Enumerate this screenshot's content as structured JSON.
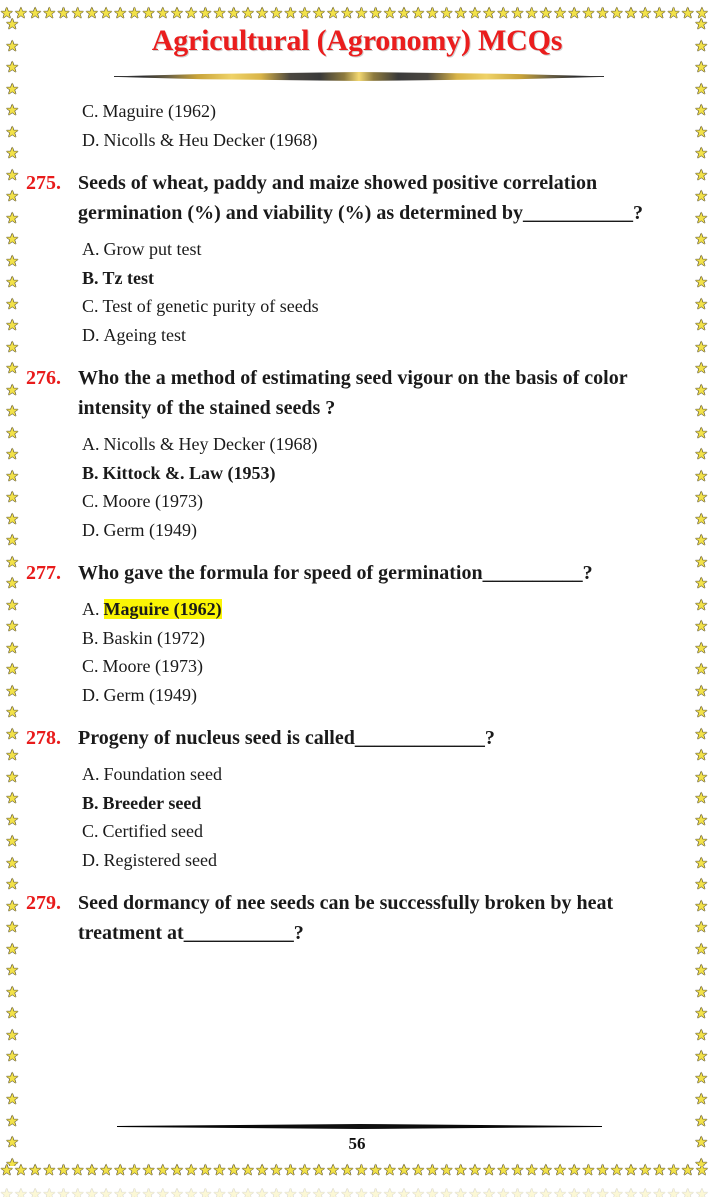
{
  "document": {
    "title": "Agricultural (Agronomy) MCQs",
    "page_number": "56",
    "border_star_glyph": "★",
    "colors": {
      "title_red": "#ea1d1d",
      "question_number_red": "#e81b1b",
      "highlight_yellow": "#fbf505",
      "star_gold": "#f2e24a",
      "text_black": "#1a1a1a"
    }
  },
  "continued_options": [
    {
      "label": "C.",
      "text": "Maguire (1962)"
    },
    {
      "label": "D.",
      "text": "Nicolls & Heu Decker (1968)"
    }
  ],
  "questions": [
    {
      "number": "275.",
      "text": "Seeds of wheat, paddy and maize showed positive correlation germination (%) and viability (%) as determined by___________?",
      "options": [
        {
          "label": "A.",
          "text": "Grow put test",
          "highlight": "none"
        },
        {
          "label": "B.",
          "text": "Tz test",
          "highlight": "full"
        },
        {
          "label": "C.",
          "text": "Test of genetic purity of seeds",
          "highlight": "none"
        },
        {
          "label": "D.",
          "text": "Ageing test",
          "highlight": "none"
        }
      ]
    },
    {
      "number": "276.",
      "text": "Who the a method of estimating seed vigour on the basis of color intensity of the stained seeds ?",
      "options": [
        {
          "label": "A.",
          "text": "Nicolls & Hey Decker (1968)",
          "highlight": "none"
        },
        {
          "label": "B.",
          "text": "Kittock &. Law (1953)",
          "highlight": "full"
        },
        {
          "label": "C.",
          "text": "Moore (1973)",
          "highlight": "none"
        },
        {
          "label": "D.",
          "text": "Germ (1949)",
          "highlight": "none"
        }
      ]
    },
    {
      "number": "277.",
      "text": "Who gave the formula for speed of germination__________?",
      "options": [
        {
          "label": "A.",
          "text": "Maguire (1962)",
          "highlight": "text-only"
        },
        {
          "label": "B.",
          "text": "Baskin (1972)",
          "highlight": "none"
        },
        {
          "label": "C.",
          "text": "Moore (1973)",
          "highlight": "none"
        },
        {
          "label": "D.",
          "text": "Germ (1949)",
          "highlight": "none"
        }
      ]
    },
    {
      "number": "278.",
      "text": "Progeny of nucleus seed is called_____________?",
      "options": [
        {
          "label": "A.",
          "text": "Foundation seed",
          "highlight": "none"
        },
        {
          "label": "B.",
          "text": "Breeder seed",
          "highlight": "full"
        },
        {
          "label": "C.",
          "text": "Certified seed",
          "highlight": "none"
        },
        {
          "label": "D.",
          "text": "Registered seed",
          "highlight": "none"
        }
      ]
    },
    {
      "number": "279.",
      "text": "Seed dormancy of nee seeds can be successfully broken by heat treatment at___________?",
      "options": []
    }
  ]
}
